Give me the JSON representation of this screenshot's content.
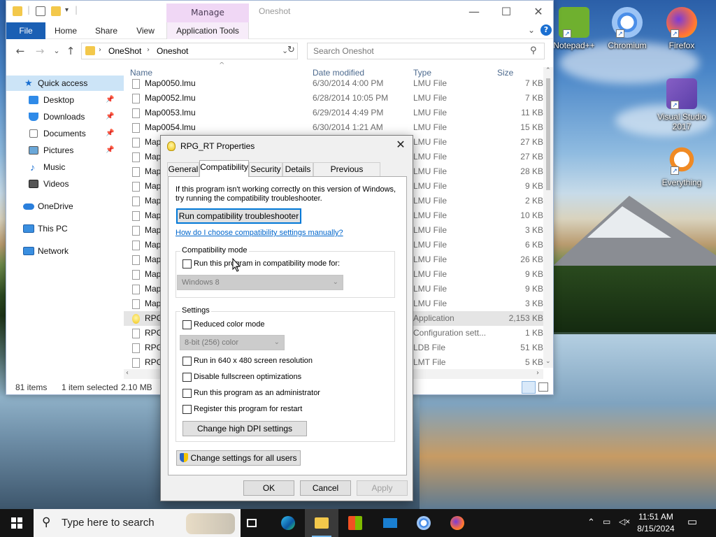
{
  "desktop": {
    "icons": [
      {
        "label": "Notepad++",
        "color": "#6fb02f",
        "icon": "notepadpp-icon"
      },
      {
        "label": "Chromium",
        "color": "#4a8ee8",
        "icon": "chromium-icon"
      },
      {
        "label": "Firefox",
        "color": "#ff7139",
        "icon": "firefox-icon"
      },
      {
        "label": "Visual Studio 2017",
        "color": "#865fc5",
        "icon": "visual-studio-icon"
      },
      {
        "label": "Everything",
        "color": "#f08a24",
        "icon": "everything-icon"
      }
    ]
  },
  "explorer": {
    "title": "Oneshot",
    "contextual_tab": "Manage",
    "ribbon_tabs": [
      "File",
      "Home",
      "Share",
      "View",
      "Application Tools"
    ],
    "address": {
      "crumbs": [
        "OneShot",
        "Oneshot"
      ]
    },
    "search_placeholder": "Search Oneshot",
    "sidebar": {
      "quick_access": "Quick access",
      "items": [
        "Desktop",
        "Downloads",
        "Documents",
        "Pictures",
        "Music",
        "Videos"
      ],
      "onedrive": "OneDrive",
      "this_pc": "This PC",
      "network": "Network"
    },
    "columns": [
      "Name",
      "Date modified",
      "Type",
      "Size"
    ],
    "files": [
      {
        "name": "Map0050.lmu",
        "date": "6/30/2014 4:00 PM",
        "type": "LMU File",
        "size": "7 KB"
      },
      {
        "name": "Map0052.lmu",
        "date": "6/28/2014 10:05 PM",
        "type": "LMU File",
        "size": "7 KB"
      },
      {
        "name": "Map0053.lmu",
        "date": "6/29/2014 4:49 PM",
        "type": "LMU File",
        "size": "11 KB"
      },
      {
        "name": "Map0054.lmu",
        "date": "6/30/2014 1:21 AM",
        "type": "LMU File",
        "size": "15 KB"
      },
      {
        "name": "Map",
        "date": "",
        "type": "LMU File",
        "size": "27 KB"
      },
      {
        "name": "Map",
        "date": "",
        "type": "LMU File",
        "size": "27 KB"
      },
      {
        "name": "Map",
        "date": "",
        "type": "LMU File",
        "size": "28 KB"
      },
      {
        "name": "Map",
        "date": "",
        "type": "LMU File",
        "size": "9 KB"
      },
      {
        "name": "Map",
        "date": "",
        "type": "LMU File",
        "size": "2 KB"
      },
      {
        "name": "Map",
        "date": "",
        "type": "LMU File",
        "size": "10 KB"
      },
      {
        "name": "Map",
        "date": "",
        "type": "LMU File",
        "size": "3 KB"
      },
      {
        "name": "Map",
        "date": "",
        "type": "LMU File",
        "size": "6 KB"
      },
      {
        "name": "Map",
        "date": "",
        "type": "LMU File",
        "size": "26 KB"
      },
      {
        "name": "Map",
        "date": "",
        "type": "LMU File",
        "size": "9 KB"
      },
      {
        "name": "Map",
        "date": "",
        "type": "LMU File",
        "size": "9 KB"
      },
      {
        "name": "Map",
        "date": "",
        "type": "LMU File",
        "size": "3 KB"
      },
      {
        "name": "RPG",
        "date": "",
        "type": "Application",
        "size": "2,153 KB",
        "selected": true
      },
      {
        "name": "RPG",
        "date": "",
        "type": "Configuration sett...",
        "size": "1 KB"
      },
      {
        "name": "RPG",
        "date": "",
        "type": "LDB File",
        "size": "51 KB"
      },
      {
        "name": "RPG",
        "date": "",
        "type": "LMT File",
        "size": "5 KB"
      }
    ],
    "status": {
      "count": "81 items",
      "selected": "1 item selected",
      "size": "2.10 MB"
    }
  },
  "dialog": {
    "title": "RPG_RT Properties",
    "tabs": [
      "General",
      "Compatibility",
      "Security",
      "Details",
      "Previous Versions"
    ],
    "intro": "If this program isn't working correctly on this version of Windows, try running the compatibility troubleshooter.",
    "troubleshooter_button": "Run compatibility troubleshooter",
    "manual_link": "How do I choose compatibility settings manually?",
    "compat_group": "Compatibility mode",
    "compat_checkbox": "Run this program in compatibility mode for:",
    "compat_os": "Windows 8",
    "settings_group": "Settings",
    "reduced_color": "Reduced color mode",
    "color_option": "8-bit (256) color",
    "res640": "Run in 640 x 480 screen resolution",
    "disable_fullscreen": "Disable fullscreen optimizations",
    "run_admin": "Run this program as an administrator",
    "register_restart": "Register this program for restart",
    "dpi_button": "Change high DPI settings",
    "all_users_button": "Change settings for all users",
    "ok": "OK",
    "cancel": "Cancel",
    "apply": "Apply"
  },
  "taskbar": {
    "search_placeholder": "Type here to search",
    "time": "11:51 AM",
    "date": "8/15/2024"
  }
}
